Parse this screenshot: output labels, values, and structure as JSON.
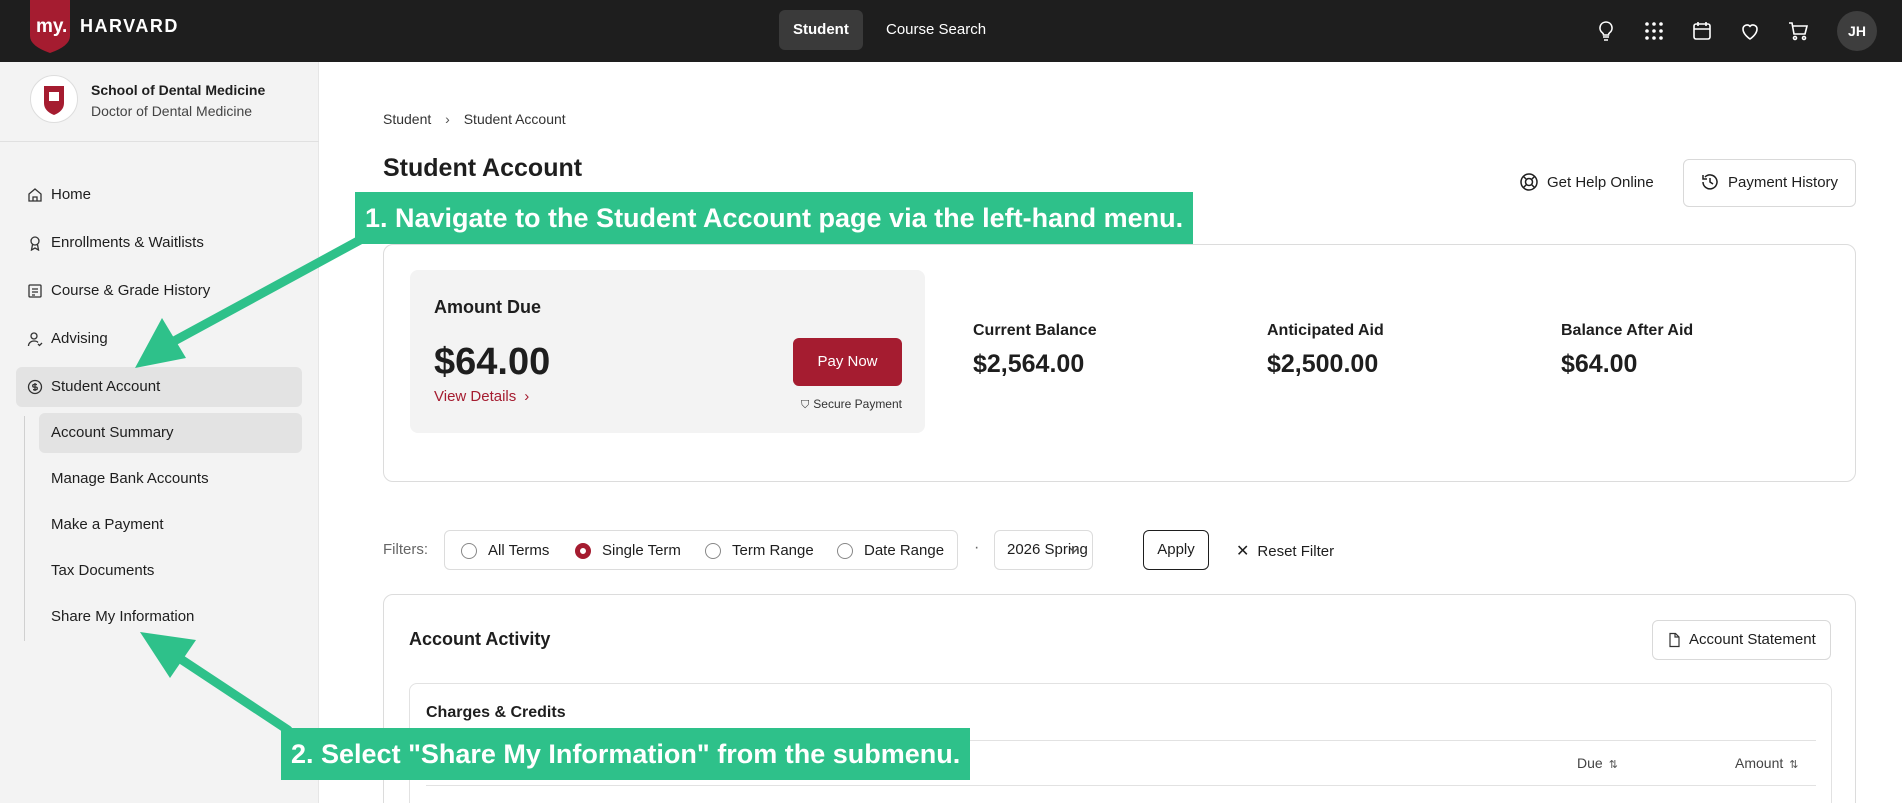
{
  "topbar": {
    "logo_my": "my.",
    "logo_name": "HARVARD",
    "nav": [
      {
        "label": "Student",
        "active": true
      },
      {
        "label": "Course Search",
        "active": false
      }
    ],
    "icons": [
      "lightbulb-icon",
      "apps-grid-icon",
      "calendar-icon",
      "heart-icon",
      "cart-icon"
    ],
    "avatar_initials": "JH"
  },
  "sidebar": {
    "school_name": "School of Dental Medicine",
    "school_degree": "Doctor of Dental Medicine",
    "items": [
      {
        "label": "Home",
        "icon": "home-icon"
      },
      {
        "label": "Enrollments & Waitlists",
        "icon": "ribbon-icon"
      },
      {
        "label": "Course & Grade History",
        "icon": "history-list-icon"
      },
      {
        "label": "Advising",
        "icon": "user-advising-icon"
      },
      {
        "label": "Student Account",
        "icon": "dollar-circle-icon",
        "active": true
      }
    ],
    "subitems": [
      {
        "label": "Account Summary",
        "active": true
      },
      {
        "label": "Manage Bank Accounts"
      },
      {
        "label": "Make a Payment"
      },
      {
        "label": "Tax Documents"
      },
      {
        "label": "Share My Information"
      }
    ]
  },
  "main": {
    "breadcrumb": [
      "Student",
      "Student Account"
    ],
    "title": "Student Account",
    "help_label": "Get Help Online",
    "history_label": "Payment History",
    "summary": {
      "amount_due_label": "Amount Due",
      "amount_due": "$64.00",
      "view_details": "View Details",
      "pay_now": "Pay Now",
      "secure_payment": "Secure Payment",
      "stats": [
        {
          "label": "Current Balance",
          "value": "$2,564.00"
        },
        {
          "label": "Anticipated Aid",
          "value": "$2,500.00"
        },
        {
          "label": "Balance After Aid",
          "value": "$64.00"
        }
      ]
    },
    "filters": {
      "label": "Filters:",
      "options": [
        {
          "label": "All Terms",
          "selected": false
        },
        {
          "label": "Single Term",
          "selected": true
        },
        {
          "label": "Term Range",
          "selected": false
        },
        {
          "label": "Date Range",
          "selected": false
        }
      ],
      "separator": "·",
      "term_value": "2026 Spring",
      "apply": "Apply",
      "reset": "Reset Filter"
    },
    "activity": {
      "title": "Account Activity",
      "statement_label": "Account Statement",
      "charges_title": "Charges & Credits",
      "columns": [
        "Due",
        "Amount"
      ]
    }
  },
  "annotations": {
    "step1": "1. Navigate to the Student Account page via the left-hand menu.",
    "step2": "2. Select \"Share My Information\" from the submenu."
  },
  "colors": {
    "brand": "#a51c30",
    "topbar": "#1e1e1e",
    "callout": "#2ec18a"
  }
}
